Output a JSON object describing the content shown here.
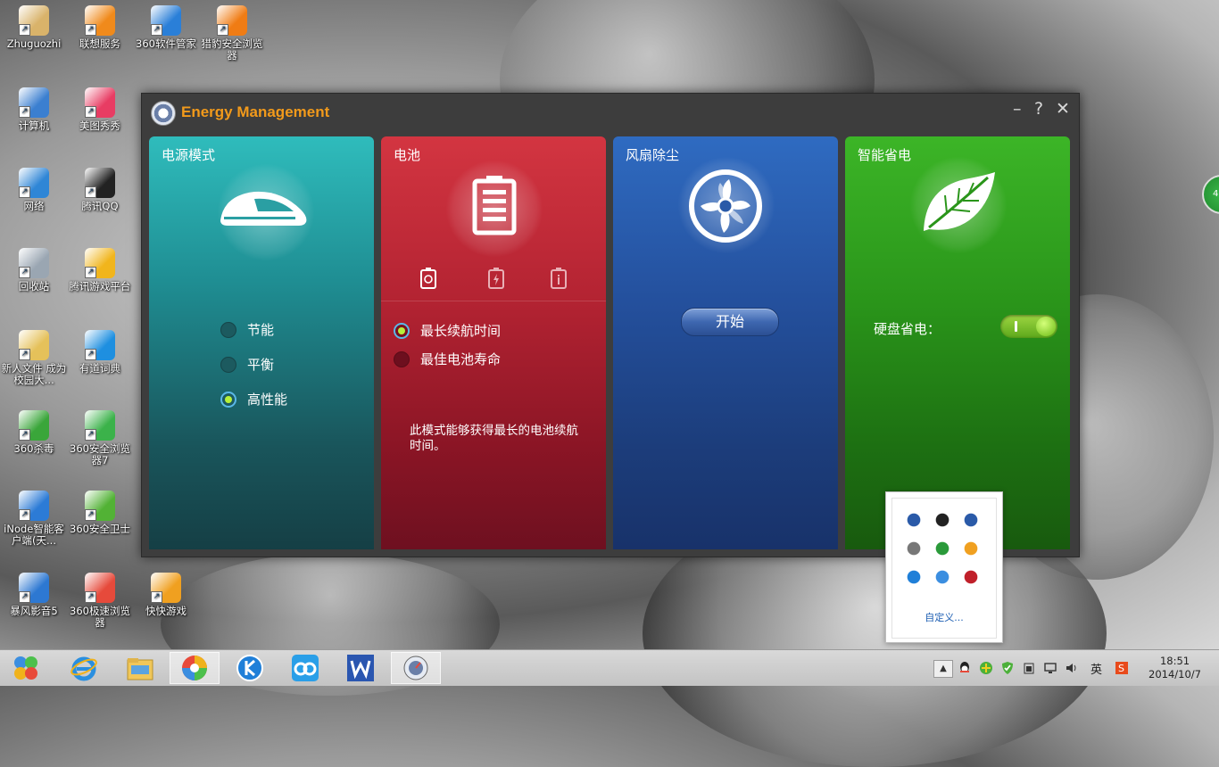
{
  "desktop": {
    "icons": [
      {
        "label": "Zhuguozhi",
        "icon": "user-folder-icon",
        "color": "#d9b36a"
      },
      {
        "label": "联想服务",
        "icon": "lenovo-service-icon",
        "color": "#f08a1b"
      },
      {
        "label": "360软件管家",
        "icon": "360-software-manager-icon",
        "color": "#2a7fd8"
      },
      {
        "label": "猎豹安全浏览器",
        "icon": "cheetah-browser-icon",
        "color": "#f07c14"
      },
      {
        "label": "计算机",
        "icon": "computer-icon",
        "color": "#3b7fd0"
      },
      {
        "label": "美图秀秀",
        "icon": "meitu-icon",
        "color": "#e83c63"
      },
      {
        "label": "网络",
        "icon": "network-icon",
        "color": "#2f86d6"
      },
      {
        "label": "腾讯QQ",
        "icon": "qq-icon",
        "color": "#222222"
      },
      {
        "label": "回收站",
        "icon": "recycle-bin-icon",
        "color": "#9aa6b2"
      },
      {
        "label": "腾讯游戏平台",
        "icon": "tencent-games-icon",
        "color": "#f1b51c"
      },
      {
        "label": "新人文件 成为校园大...",
        "icon": "folder-icon",
        "color": "#e5c15a"
      },
      {
        "label": "有道词典",
        "icon": "youdao-dict-icon",
        "color": "#1e8fe0"
      },
      {
        "label": "360杀毒",
        "icon": "360-antivirus-icon",
        "color": "#3aa63a"
      },
      {
        "label": "360安全浏览器7",
        "icon": "360-browser-icon",
        "color": "#3bb24a"
      },
      {
        "label": "iNode智能客户端(天...",
        "icon": "inode-icon",
        "color": "#2c7bd6"
      },
      {
        "label": "360安全卫士",
        "icon": "360-safeguard-icon",
        "color": "#52b235"
      },
      {
        "label": "暴风影音5",
        "icon": "baofeng-icon",
        "color": "#2d78d2"
      },
      {
        "label": "360极速浏览器",
        "icon": "360-speed-browser-icon",
        "color": "#e64a3b"
      },
      {
        "label": "快快游戏",
        "icon": "kuaikuai-games-icon",
        "color": "#f0a020"
      }
    ]
  },
  "window": {
    "title": "Energy Management",
    "minimize_label": "–",
    "help_label": "?",
    "close_label": "✕",
    "panels": {
      "power": {
        "title": "电源模式",
        "icon": "train-icon",
        "options": [
          "节能",
          "平衡",
          "高性能"
        ],
        "selected": "高性能"
      },
      "battery": {
        "title": "电池",
        "icon": "battery-icon",
        "tabs": [
          "battery-refresh-icon",
          "battery-charge-icon",
          "battery-info-icon"
        ],
        "options": [
          "最长续航时间",
          "最佳电池寿命"
        ],
        "selected": "最长续航时间",
        "description": "此模式能够获得最长的电池续航时间。"
      },
      "fan": {
        "title": "风扇除尘",
        "icon": "fan-icon",
        "start_label": "开始"
      },
      "smart": {
        "title": "智能省电",
        "icon": "leaf-icon",
        "hdd_label": "硬盘省电：",
        "hdd_on": true
      }
    }
  },
  "tray_popup": {
    "icons": [
      "dolby-icon",
      "bluetooth-icon",
      "energy-icon",
      "flag-icon",
      "network-share-icon",
      "update-icon",
      "kugou-icon",
      "360-icon",
      "monitor-icon"
    ],
    "customize_label": "自定义..."
  },
  "side_badge": "48",
  "taskbar": {
    "apps": [
      "start-orb-icon",
      "ie-icon",
      "file-explorer-icon",
      "360-speed-browser-icon",
      "kugou-icon",
      "baidu-cloud-icon",
      "wps-icon",
      "energy-management-icon"
    ],
    "ime_label": "英",
    "clock_time": "18:51",
    "clock_date": "2014/10/7"
  },
  "colors": {
    "title_orange": "#f29a1b",
    "power_teal": "#2fbcbc",
    "battery_red": "#d33541",
    "fan_blue": "#2f6bc1",
    "smart_green": "#3cb527"
  }
}
